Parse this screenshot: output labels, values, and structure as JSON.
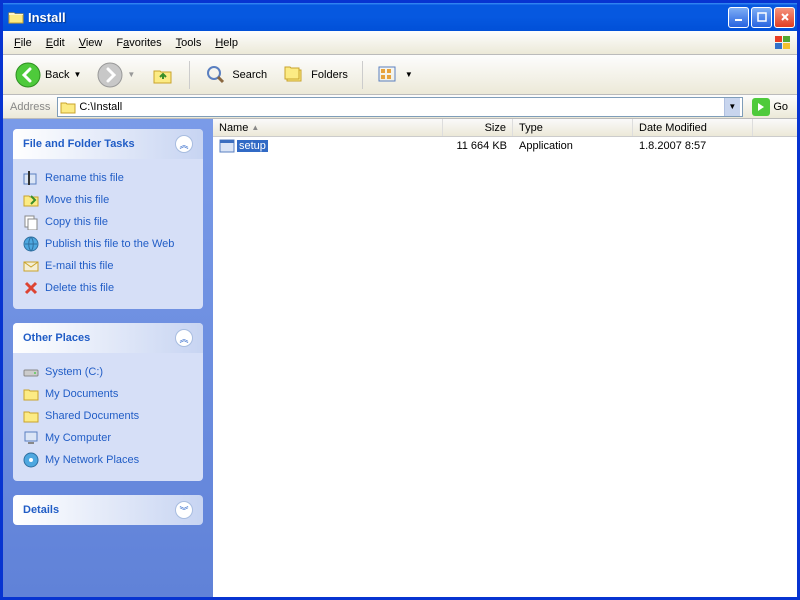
{
  "window": {
    "title": "Install"
  },
  "menu": {
    "file": "File",
    "edit": "Edit",
    "view": "View",
    "favorites": "Favorites",
    "tools": "Tools",
    "help": "Help"
  },
  "toolbar": {
    "back": "Back",
    "search": "Search",
    "folders": "Folders"
  },
  "addressbar": {
    "label": "Address",
    "path": "C:\\Install",
    "go": "Go"
  },
  "sidebar": {
    "tasks_title": "File and Folder Tasks",
    "tasks": [
      {
        "label": "Rename this file"
      },
      {
        "label": "Move this file"
      },
      {
        "label": "Copy this file"
      },
      {
        "label": "Publish this file to the Web"
      },
      {
        "label": "E-mail this file"
      },
      {
        "label": "Delete this file"
      }
    ],
    "places_title": "Other Places",
    "places": [
      {
        "label": "System (C:)"
      },
      {
        "label": "My Documents"
      },
      {
        "label": "Shared Documents"
      },
      {
        "label": "My Computer"
      },
      {
        "label": "My Network Places"
      }
    ],
    "details_title": "Details"
  },
  "columns": {
    "name": "Name",
    "size": "Size",
    "type": "Type",
    "date": "Date Modified"
  },
  "files": [
    {
      "name": "setup",
      "size": "11 664 KB",
      "type": "Application",
      "date": "1.8.2007 8:57"
    }
  ]
}
